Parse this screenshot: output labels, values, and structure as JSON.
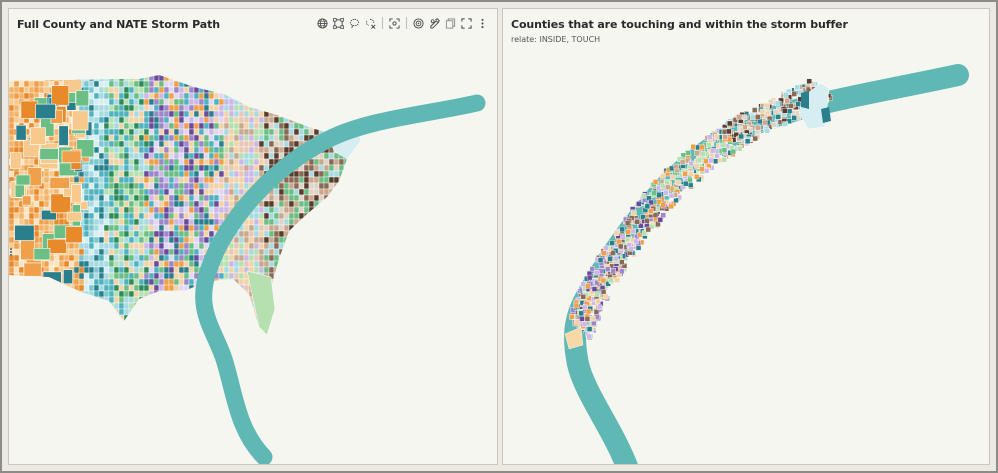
{
  "left_panel": {
    "title": "Full County and NATE Storm Path",
    "toolbar": [
      {
        "name": "globe-icon"
      },
      {
        "name": "rectangle-select-icon"
      },
      {
        "name": "lasso-select-icon"
      },
      {
        "name": "lasso-clear-icon"
      },
      {
        "name": "separator"
      },
      {
        "name": "zoom-extent-icon"
      },
      {
        "name": "separator"
      },
      {
        "name": "radius-select-icon"
      },
      {
        "name": "edit-layer-icon"
      },
      {
        "name": "copy-icon"
      },
      {
        "name": "fullscreen-icon"
      },
      {
        "name": "more-options-icon"
      }
    ]
  },
  "right_panel": {
    "title": "Counties that are touching and within the storm buffer",
    "subtitle": "relate: INSIDE, TOUCH"
  },
  "colors": {
    "storm_path": "#5fb8b4",
    "panel_bg": "#f6f6f1",
    "county_palette": [
      "#f0a04b",
      "#e8892a",
      "#f7c98c",
      "#4fb3bf",
      "#2a7f8c",
      "#a6dbe3",
      "#6cbf84",
      "#2e8b57",
      "#b7e0b0",
      "#9b87c9",
      "#6a4a9a",
      "#cbb8e6",
      "#8a6a55",
      "#5a3c2c",
      "#c9a88d",
      "#f2d3a8",
      "#e0e0d6"
    ]
  }
}
